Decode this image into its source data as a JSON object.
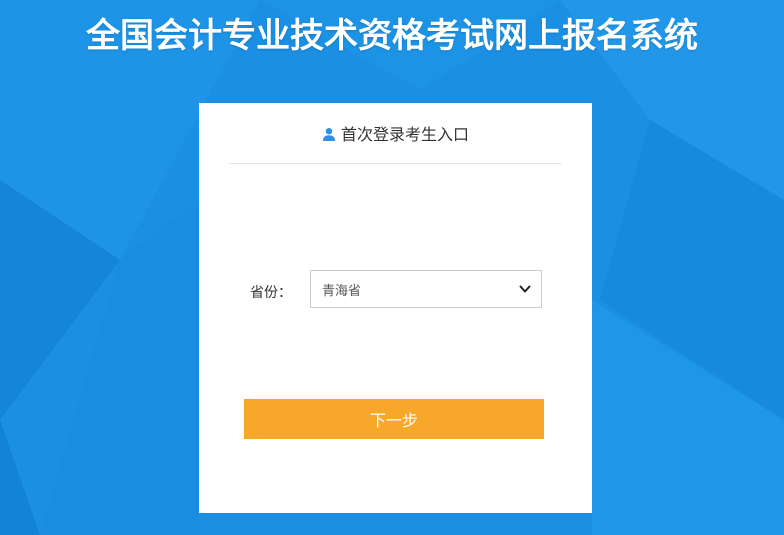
{
  "header": {
    "title": "全国会计专业技术资格考试网上报名系统"
  },
  "login_card": {
    "heading": "首次登录考生入口",
    "heading_icon": "user-icon",
    "province": {
      "label": "省份：",
      "selected_value": "青海省"
    },
    "next_button_label": "下一步"
  },
  "colors": {
    "background": "#1a8fe3",
    "accent_button": "#f7a82a",
    "icon_blue": "#2d8fe6"
  }
}
